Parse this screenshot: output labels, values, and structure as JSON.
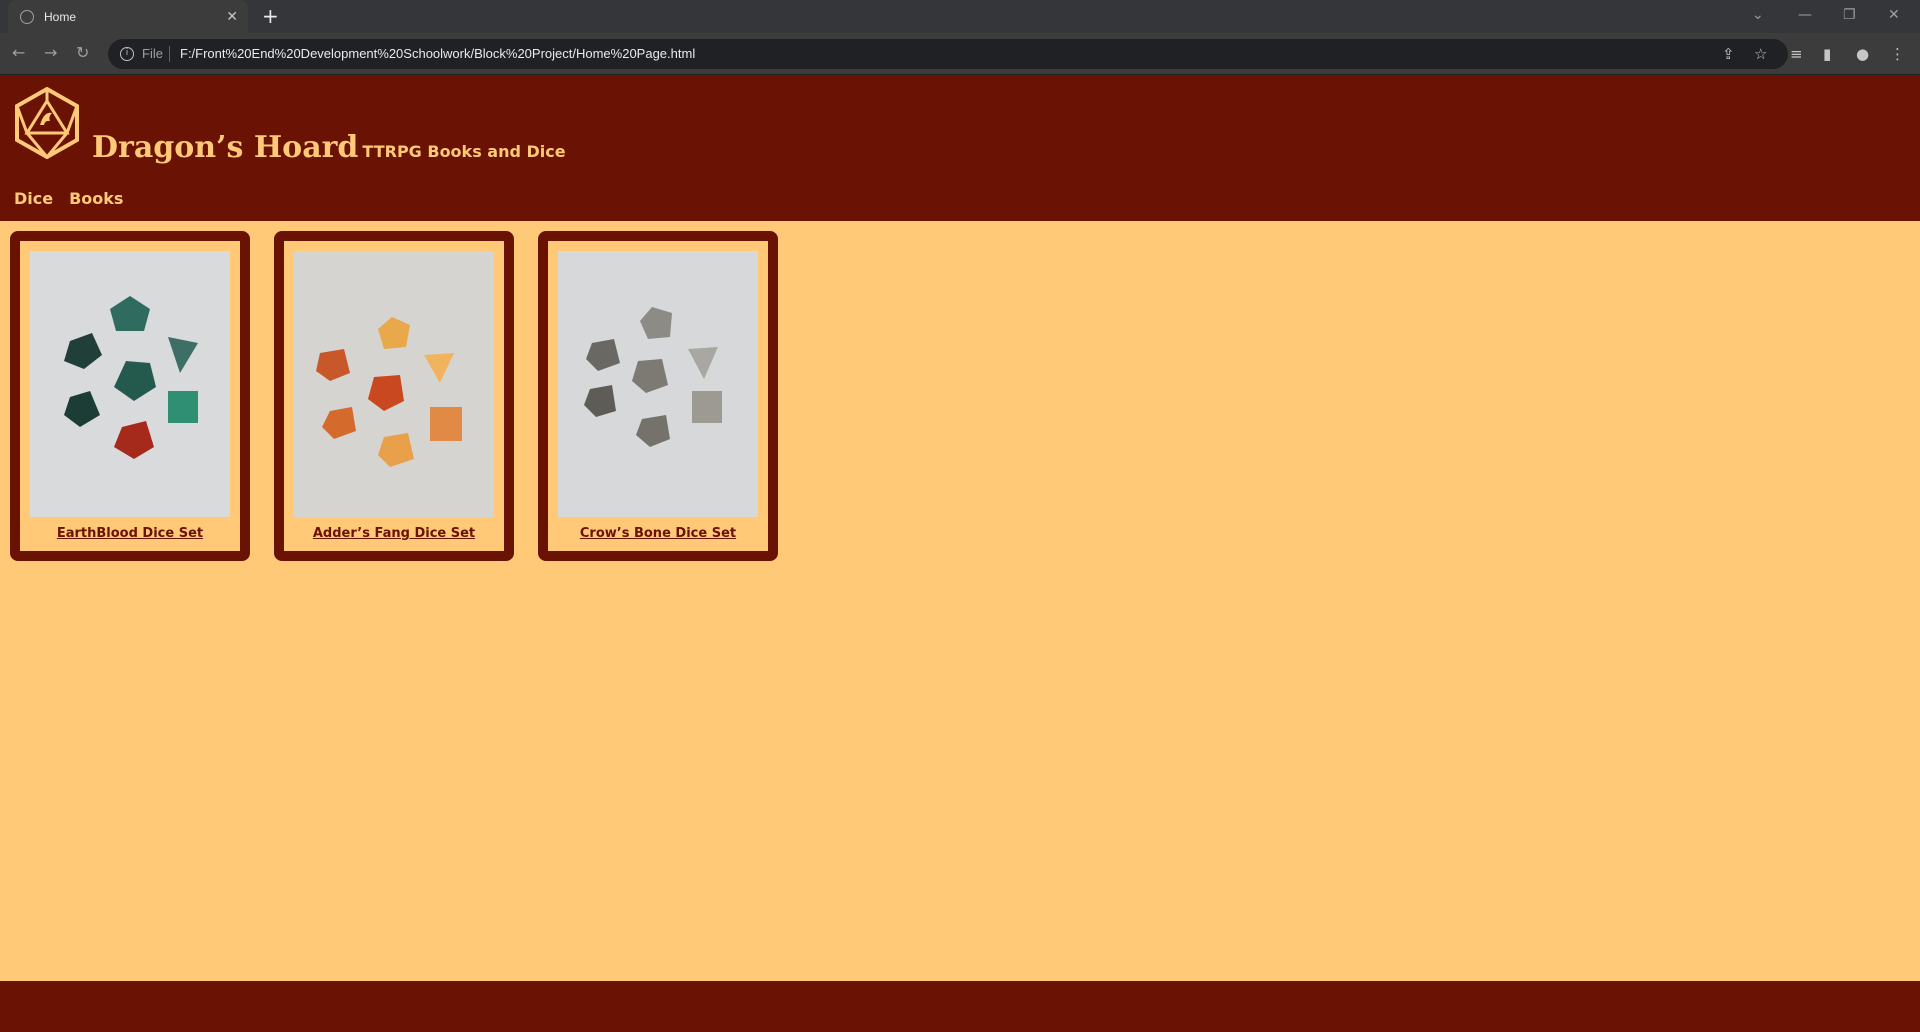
{
  "browser": {
    "tab_title": "Home",
    "file_label": "File",
    "url": "F:/Front%20End%20Development%20Schoolwork/Block%20Project/Home%20Page.html"
  },
  "site": {
    "brand": "Dragon’s Hoard",
    "tagline": "TTRPG Books and Dice",
    "nav": [
      {
        "label": "Dice"
      },
      {
        "label": "Books"
      }
    ],
    "products": [
      {
        "name": "EarthBlood Dice Set"
      },
      {
        "name": "Adder’s Fang Dice Set"
      },
      {
        "name": "Crow’s Bone Dice Set"
      }
    ]
  },
  "colors": {
    "accent": "#6a1203",
    "background": "#ffc978"
  }
}
